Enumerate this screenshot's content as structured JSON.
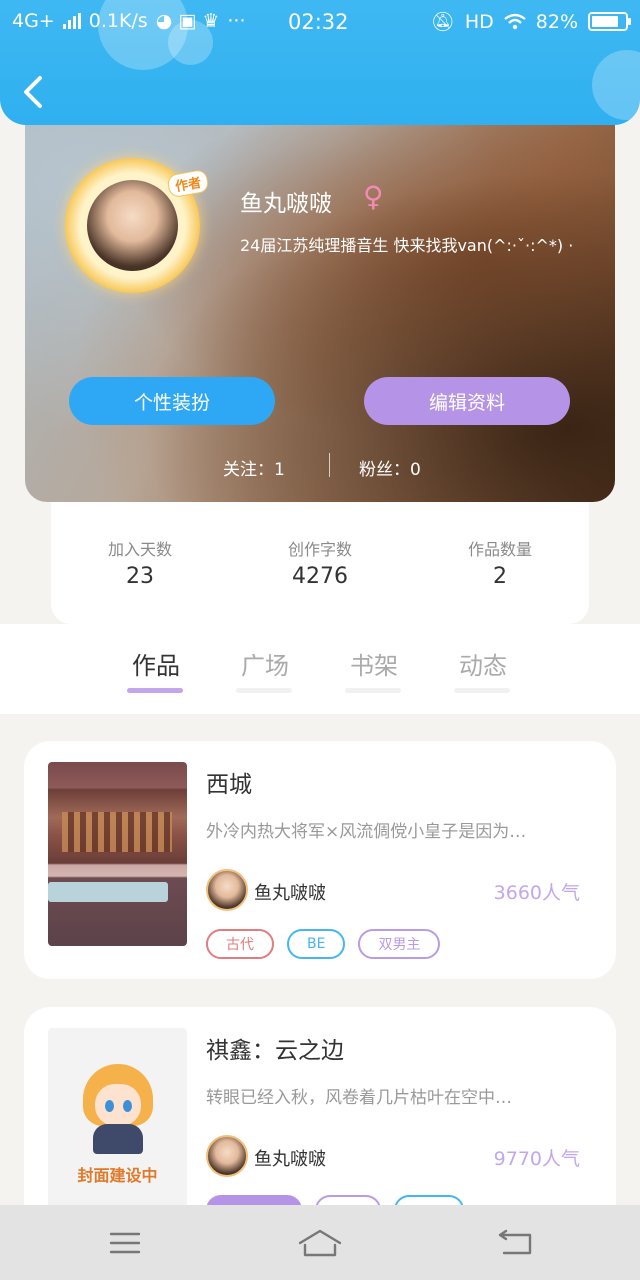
{
  "status_bar": {
    "network": "4G+",
    "speed": "0.1K/s",
    "time": "02:32",
    "hd": "HD",
    "battery": "82%",
    "battery_level": 0.82
  },
  "profile": {
    "badge": "作者",
    "name": "鱼丸啵啵",
    "gender_symbol": "♀",
    "bio": "24届江苏纯理播音生 快来找我van(^:·ˇ·:^*) ·",
    "decor_button": "个性装扮",
    "edit_button": "编辑资料",
    "following_label": "关注：1",
    "followers_label": "粉丝：0"
  },
  "stats": [
    {
      "label": "加入天数",
      "value": "23"
    },
    {
      "label": "创作字数",
      "value": "4276"
    },
    {
      "label": "作品数量",
      "value": "2"
    }
  ],
  "tabs": [
    {
      "label": "作品"
    },
    {
      "label": "广场"
    },
    {
      "label": "书架"
    },
    {
      "label": "动态"
    }
  ],
  "works": [
    {
      "title": "西城",
      "desc": "外冷内热大将军×风流倜傥小皇子是因为…",
      "author": "鱼丸啵啵",
      "popularity": "3660人气",
      "tags": [
        "古代",
        "BE",
        "双男主"
      ]
    },
    {
      "title": "祺鑫：云之边",
      "desc": "转眼已经入秋，风卷着几片枯叶在空中…",
      "author": "鱼丸啵啵",
      "popularity": "9770人气",
      "cover_text": "封面建设中"
    }
  ],
  "colors": {
    "header_blue": "#2fb0f0",
    "accent_purple": "#b593e6",
    "button_blue": "#2ea8f5"
  }
}
